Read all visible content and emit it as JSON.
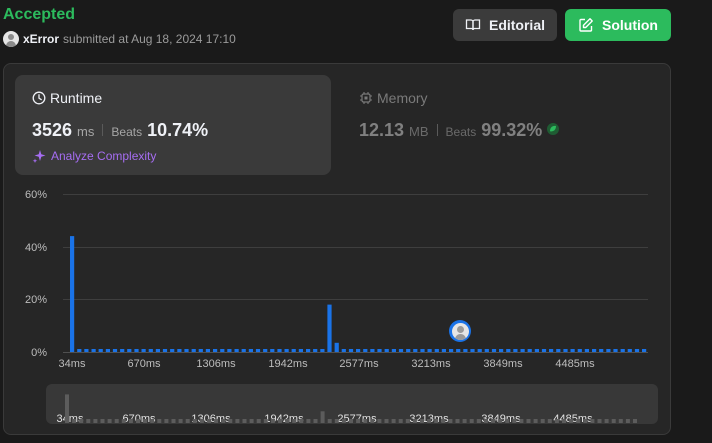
{
  "submission": {
    "status": "Accepted",
    "username": "xError",
    "submitted_text": "submitted at Aug 18, 2024 17:10"
  },
  "header": {
    "editorial_label": "Editorial",
    "solution_label": "Solution"
  },
  "runtime": {
    "title": "Runtime",
    "value": "3526",
    "unit": "ms",
    "beats_label": "Beats",
    "beats_value": "10.74%",
    "analyze_label": "Analyze Complexity"
  },
  "memory": {
    "title": "Memory",
    "value": "12.13",
    "unit": "MB",
    "beats_label": "Beats",
    "beats_value": "99.32%"
  },
  "colors": {
    "accent_green": "#2cbb5d",
    "bar_blue": "#1a73e8",
    "analyze_purple": "#a66df2"
  },
  "chart_data": {
    "type": "bar",
    "ylabel_ticks": [
      "0%",
      "20%",
      "40%",
      "60%"
    ],
    "ylim": [
      0,
      60
    ],
    "xtick_labels": [
      "34ms",
      "670ms",
      "1306ms",
      "1942ms",
      "2577ms",
      "3213ms",
      "3849ms",
      "4485ms"
    ],
    "x_range_ms": [
      34,
      5050
    ],
    "values": [
      44,
      1,
      1,
      1,
      1,
      1,
      1,
      1,
      1,
      1,
      1,
      1,
      1,
      1,
      1,
      1,
      1,
      1,
      1,
      1,
      1,
      1,
      1,
      1,
      1,
      1,
      1,
      1,
      1,
      1,
      1,
      1,
      1,
      1,
      1,
      1,
      18,
      3.5,
      1,
      1,
      1,
      1,
      1,
      1,
      1,
      1,
      1,
      1,
      1,
      1,
      1,
      1,
      1,
      1,
      1,
      1,
      1,
      1,
      1,
      1,
      1,
      1,
      1,
      1,
      1,
      1,
      1,
      1,
      1,
      1,
      1,
      1,
      1,
      1,
      1,
      1,
      1,
      1,
      1,
      1,
      1,
      1,
      1,
      1,
      1,
      1,
      1,
      1,
      1,
      1,
      1,
      1,
      1,
      1,
      1,
      1,
      1,
      1,
      1,
      1,
      1,
      1,
      1,
      1,
      1,
      1,
      1,
      1,
      1,
      1,
      1,
      1,
      1
    ],
    "your_runtime_ms": 3526,
    "grid": true
  }
}
